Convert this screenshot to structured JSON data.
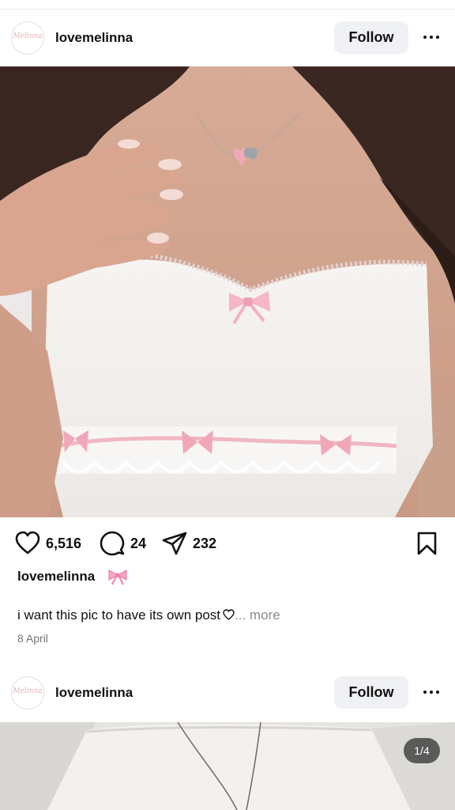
{
  "posts": [
    {
      "username": "lovemelinna",
      "avatar_text": "Melinna",
      "follow_label": "Follow",
      "likes": "6,516",
      "comments": "24",
      "shares": "232",
      "caption_user": "lovemelinna",
      "caption_text": "i want this pic to have its own post",
      "caption_more": "... more",
      "date": "8 April"
    },
    {
      "username": "lovemelinna",
      "avatar_text": "Melinna",
      "follow_label": "Follow",
      "media_counter": "1/4"
    }
  ],
  "icons": {
    "like": "heart-outline-icon",
    "comment": "comment-bubble-icon",
    "share": "paper-plane-icon",
    "save": "bookmark-icon",
    "more": "more-horizontal-icon",
    "caption_emoji": "pink-ribbon-emoji",
    "caption_heart": "heart-outline-small-icon"
  },
  "colors": {
    "follow_button_bg": "#eff1f4",
    "muted_text": "#737373",
    "ribbon_pink": "#f3a8bf"
  }
}
